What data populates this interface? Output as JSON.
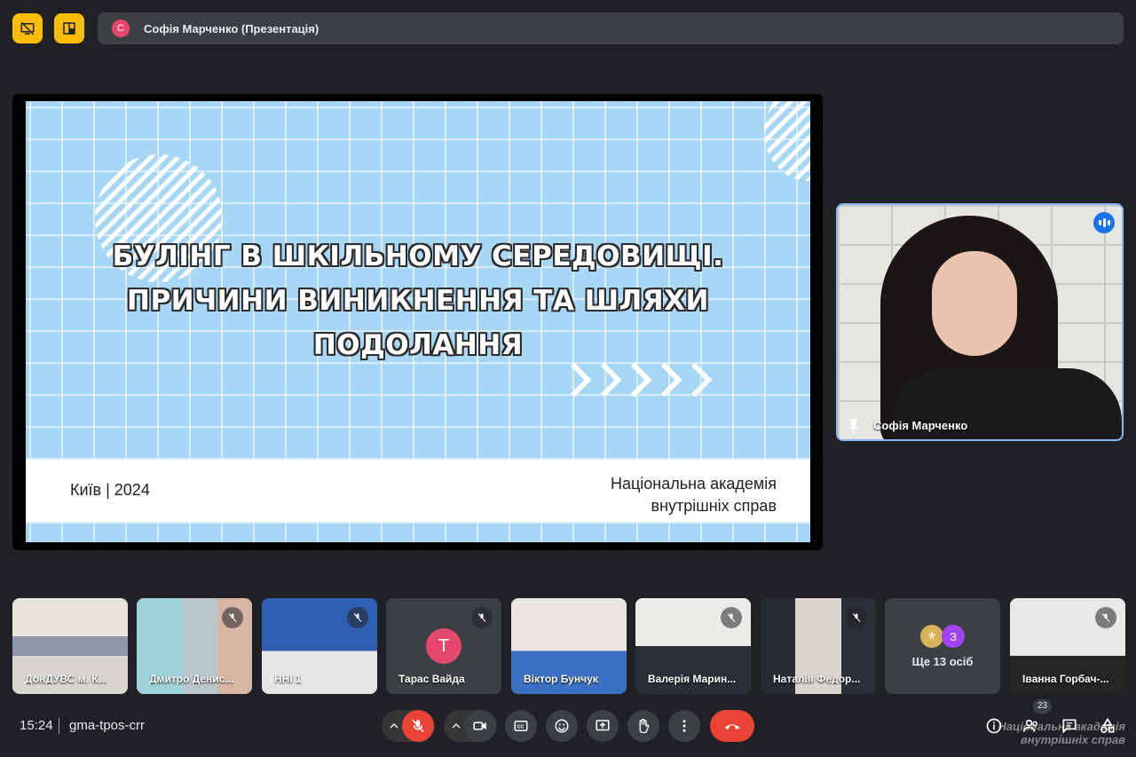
{
  "presenter_bar": {
    "avatar_letter": "С",
    "label": "Софія Марченко (Презентація)"
  },
  "slide": {
    "title_lines": [
      "БУЛІНГ В ШКІЛЬНОМУ СЕРЕДОВИЩІ.",
      "ПРИЧИНИ ВИНИКНЕННЯ ТА ШЛЯХИ",
      "ПОДОЛАННЯ"
    ],
    "city_year": "Київ | 2024",
    "org_lines": [
      "Національна академія",
      "внутрішніх справ"
    ]
  },
  "speaker": {
    "name": "Софія Марченко"
  },
  "participants": [
    {
      "name": "ДонДУВС м. К...",
      "muted": false
    },
    {
      "name": "Дмитро Денис...",
      "muted": true
    },
    {
      "name": "ННІ 1",
      "muted": true
    },
    {
      "name": "Тарас Вайда",
      "muted": true,
      "avatar_letter": "Т"
    },
    {
      "name": "Віктор Бунчук",
      "muted": false
    },
    {
      "name": "Валерія Марин...",
      "muted": true
    },
    {
      "name": "Наталія Федор...",
      "muted": true
    },
    {
      "name": "Ще 13 осіб",
      "avatar_letter": "З"
    },
    {
      "name": "Івaнна Горбач-...",
      "muted": true
    }
  ],
  "meeting": {
    "time": "15:24",
    "code": "gma-tpos-crr",
    "participant_count": "23"
  },
  "watermark": {
    "line1": "Національна академія",
    "line2": "внутрішніх справ"
  },
  "colors": {
    "accent_blue": "#8ab4f8",
    "danger_red": "#ea4335",
    "warning_yellow": "#fbbc04",
    "slide_bg": "#a8d6f5"
  }
}
